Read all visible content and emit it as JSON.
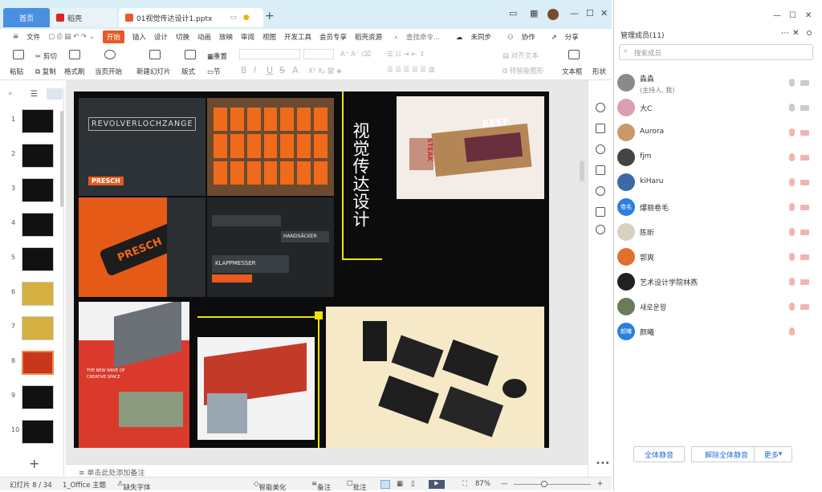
{
  "tabs": {
    "home": "首页",
    "daoke": "稻壳",
    "file": "01视觉传达设计1.pptx",
    "add": "+"
  },
  "menu": {
    "file": "文件",
    "items": [
      "开始",
      "插入",
      "设计",
      "切换",
      "动画",
      "放映",
      "审阅",
      "视图",
      "开发工具",
      "会员专享",
      "稻壳资源"
    ],
    "search": "查找命令...",
    "unsync": "未同步",
    "collab": "协作",
    "share": "分享"
  },
  "ribbon": {
    "cut": "剪切",
    "paste": "粘贴",
    "copy": "复制",
    "format_painter": "格式刷",
    "play": "当页开始",
    "new_slide": "新建幻灯片",
    "layout": "版式",
    "section": "节",
    "reset": "重置",
    "bold": "B",
    "italic": "I",
    "underline": "U",
    "strike": "S",
    "font_color": "A",
    "align_text": "对齐文本",
    "text_box": "文本框",
    "convert": "转智能图形",
    "shape": "形状"
  },
  "slide": {
    "title": "视觉传达设计",
    "brand_text": "REVOLVERLOCHZANGE",
    "brand_logo": "PRESCH",
    "product_a": "HANDSÄCKER",
    "product_b": "KLAPPMESSER",
    "beef": "BEEF",
    "steak": "STEAK",
    "brochure_text": "THE NEW WAVE OF CREATIVE SPACE"
  },
  "thumbnails": [
    "1",
    "2",
    "3",
    "4",
    "5",
    "6",
    "7",
    "8",
    "9",
    "10"
  ],
  "notes": "单击此处添加备注",
  "status": {
    "slide": "幻灯片 8 / 34",
    "theme": "1_Office 主题",
    "font": "缺失字体",
    "beautify": "智能美化",
    "notes": "备注",
    "comments": "批注",
    "zoom": "87%"
  },
  "panel": {
    "title": "管理成员(11)",
    "search": "搜索成员",
    "members": [
      {
        "name": "淼淼",
        "role": "(主持人, 我)",
        "mic": true,
        "cam": true,
        "color": "#8a8a8a"
      },
      {
        "name": "大C",
        "role": "",
        "mic": true,
        "cam": true,
        "color": "#d9a0b0"
      },
      {
        "name": "Aurora",
        "role": "",
        "mic": false,
        "cam": false,
        "color": "#c89a6a"
      },
      {
        "name": "fjm",
        "role": "",
        "mic": false,
        "cam": false,
        "color": "#444444"
      },
      {
        "name": "kiHaru",
        "role": "",
        "mic": false,
        "cam": false,
        "color": "#3a6aa8"
      },
      {
        "name": "爆丽卷毛",
        "role": "",
        "mic": false,
        "cam": false,
        "color": "#2b7fe0",
        "initial": "卷毛"
      },
      {
        "name": "陈昕",
        "role": "",
        "mic": false,
        "cam": false,
        "color": "#d8d0c0"
      },
      {
        "name": "郭爽",
        "role": "",
        "mic": false,
        "cam": false,
        "color": "#e07030"
      },
      {
        "name": "艺术设计学院林燕",
        "role": "",
        "mic": false,
        "cam": false,
        "color": "#222222"
      },
      {
        "name": "새로운왕",
        "role": "",
        "mic": false,
        "cam": false,
        "color": "#6a7a5a"
      },
      {
        "name": "颜曦",
        "role": "",
        "mic": false,
        "cam": false,
        "color": "#2b7fe0",
        "initial": "颜曦"
      }
    ],
    "mute_all": "全体静音",
    "unmute_all": "解除全体静音",
    "more": "更多"
  }
}
